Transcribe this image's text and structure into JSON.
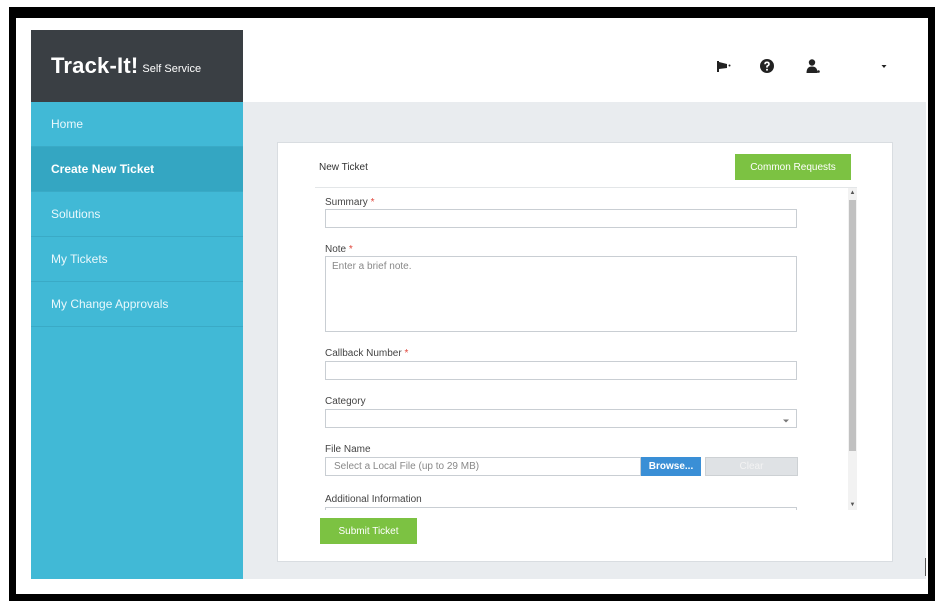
{
  "app": {
    "brand_main": "Track-It!",
    "brand_sub": "Self Service"
  },
  "sidebar": {
    "items": [
      {
        "label": "Home"
      },
      {
        "label": "Create New Ticket"
      },
      {
        "label": "Solutions"
      },
      {
        "label": "My Tickets"
      },
      {
        "label": "My Change Approvals"
      }
    ],
    "active_index": 1
  },
  "header": {
    "icons": [
      "announcement-icon",
      "help-icon",
      "user-icon",
      "caret-down-icon"
    ]
  },
  "ticket": {
    "title": "New Ticket",
    "common_requests_label": "Common Requests",
    "required_marker": "*",
    "summary": {
      "label": "Summary",
      "value": ""
    },
    "note": {
      "label": "Note",
      "placeholder": "Enter a brief note."
    },
    "callback": {
      "label": "Callback Number",
      "value": ""
    },
    "category": {
      "label": "Category",
      "value": ""
    },
    "file": {
      "label": "File Name",
      "placeholder": "Select a Local File (up to 29 MB)",
      "browse_label": "Browse...",
      "clear_label": "Clear"
    },
    "additional": {
      "label": "Additional Information"
    },
    "submit_label": "Submit Ticket"
  },
  "colors": {
    "sidebar": "#41b9d6",
    "sidebar_active": "#34a6c2",
    "brand_bg": "#3a3f44",
    "accent_green": "#7cc242",
    "browse_blue": "#3a8fd6",
    "required_red": "#e0453a"
  }
}
